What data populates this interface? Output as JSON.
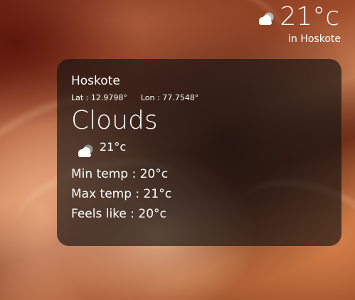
{
  "header": {
    "temperature": "21°c",
    "city_line": "in Hoskote",
    "icon": "cloud-icon"
  },
  "card": {
    "city": "Hoskote",
    "lat": "Lat : 12.9798°",
    "lon": "Lon : 77.7548°",
    "condition": "Clouds",
    "icon": "cloud-icon",
    "temperature": "21°c",
    "min_temp": "Min temp : 20°c",
    "max_temp": "Max temp : 21°c",
    "feels_like": "Feels like : 20°c"
  },
  "colors": {
    "card_background": "#141212",
    "text": "#ffffff",
    "wallpaper": "#9c4a2a"
  }
}
